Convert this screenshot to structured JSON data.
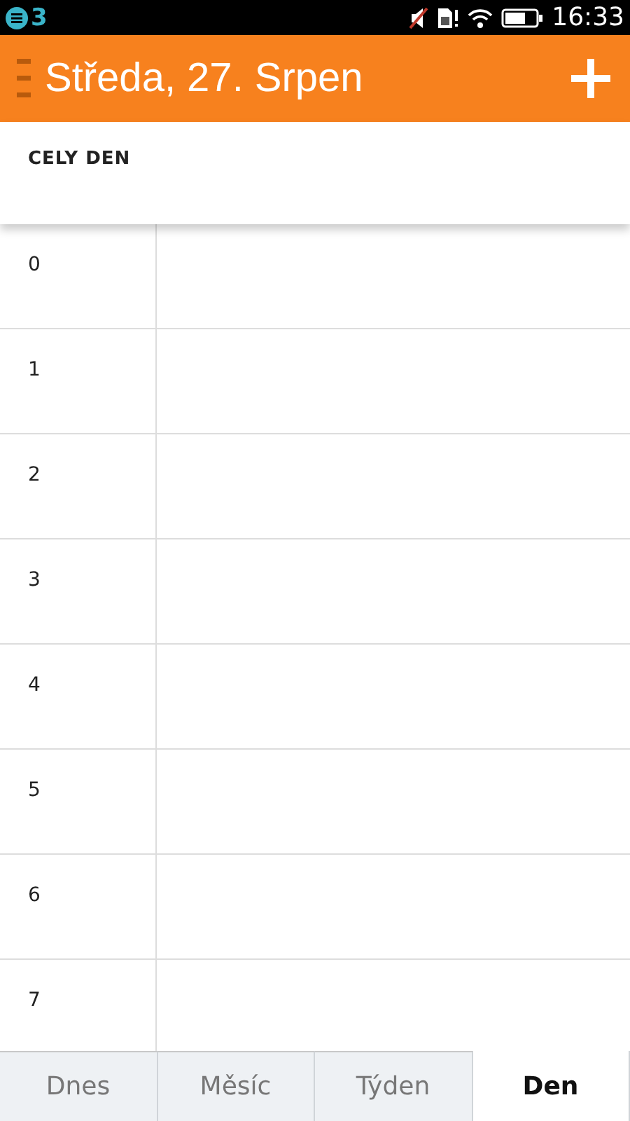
{
  "status_bar": {
    "notification_count": "3",
    "time": "16:33"
  },
  "header": {
    "title": "Středa, 27. Srpen"
  },
  "all_day": {
    "label": "CELY DEN"
  },
  "hours": [
    "0",
    "1",
    "2",
    "3",
    "4",
    "5",
    "6",
    "7"
  ],
  "tabs": [
    {
      "label": "Dnes",
      "selected": false
    },
    {
      "label": "Měsíc",
      "selected": false
    },
    {
      "label": "Týden",
      "selected": false
    },
    {
      "label": "Den",
      "selected": true
    }
  ]
}
